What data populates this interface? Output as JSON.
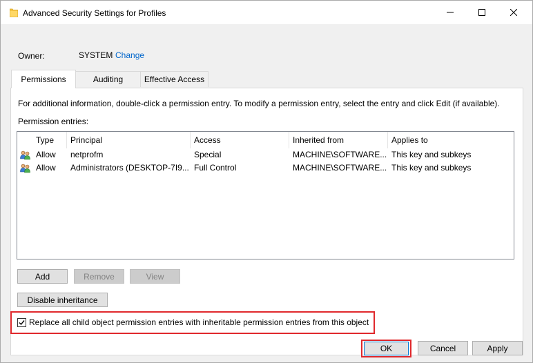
{
  "window": {
    "title": "Advanced Security Settings for Profiles",
    "folder_icon_color": "#f5c342"
  },
  "owner": {
    "label": "Owner:",
    "value": "SYSTEM",
    "change_link": "Change"
  },
  "tabs": [
    {
      "label": "Permissions",
      "active": true
    },
    {
      "label": "Auditing",
      "active": false
    },
    {
      "label": "Effective Access",
      "active": false
    }
  ],
  "permissions": {
    "info_text": "For additional information, double-click a permission entry. To modify a permission entry, select the entry and click Edit (if available).",
    "entries_label": "Permission entries:",
    "columns": [
      "Type",
      "Principal",
      "Access",
      "Inherited from",
      "Applies to"
    ],
    "rows": [
      {
        "type": "Allow",
        "principal": "netprofm",
        "access": "Special",
        "inherited_from": "MACHINE\\SOFTWARE...",
        "applies_to": "This key and subkeys"
      },
      {
        "type": "Allow",
        "principal": "Administrators (DESKTOP-7I9...",
        "access": "Full Control",
        "inherited_from": "MACHINE\\SOFTWARE...",
        "applies_to": "This key and subkeys"
      }
    ],
    "buttons": {
      "add": "Add",
      "remove": "Remove",
      "view": "View",
      "disable_inheritance": "Disable inheritance"
    },
    "replace_checkbox": {
      "label": "Replace all child object permission entries with inheritable permission entries from this object",
      "checked": true
    }
  },
  "footer": {
    "ok": "OK",
    "cancel": "Cancel",
    "apply": "Apply"
  },
  "colors": {
    "highlight": "#e0282c",
    "link": "#0066cc"
  }
}
